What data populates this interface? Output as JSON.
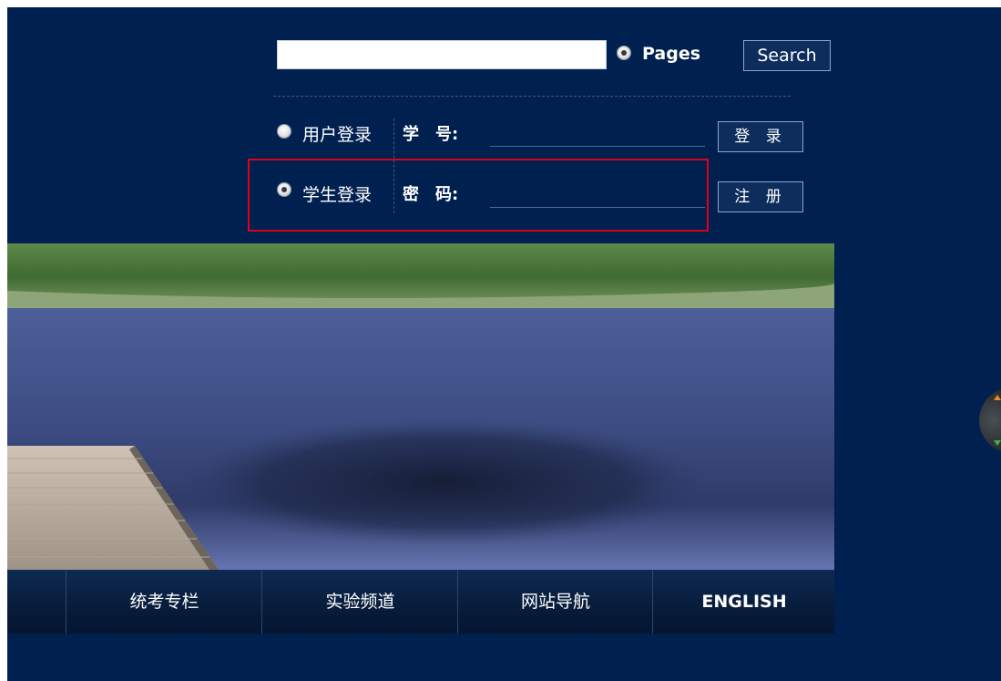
{
  "search": {
    "input_value": "",
    "scope_option_label": "Pages",
    "button_label": "Search"
  },
  "login": {
    "user_login_label": "用户登录",
    "student_login_label": "学生登录",
    "student_id_label": "学　号:",
    "password_label": "密　码:",
    "student_id_value": "",
    "password_value": "",
    "login_button_label": "登 录",
    "register_button_label": "注 册",
    "selected_role": "学生登录"
  },
  "nav": {
    "items": [
      "统考专栏",
      "实验频道",
      "网站导航",
      "ENGLISH"
    ]
  },
  "colors": {
    "page_background": "#002050",
    "highlight_box": "#e0001b"
  },
  "icons": {
    "side_widget": "scroll-widget-icon"
  }
}
